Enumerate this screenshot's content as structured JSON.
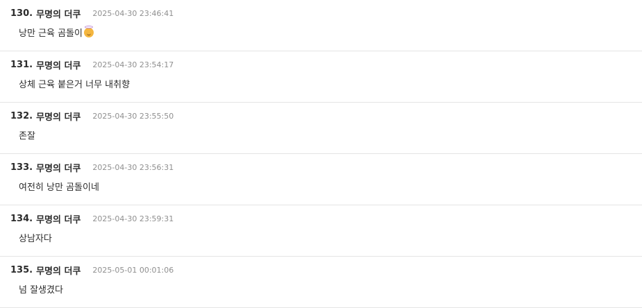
{
  "comments": [
    {
      "number": "130.",
      "author": "무명의 더쿠",
      "timestamp": "2025-04-30 23:46:41",
      "text": "낭만 근육 곰돌이",
      "emoji": "smiling-face-with-halo"
    },
    {
      "number": "131.",
      "author": "무명의 더쿠",
      "timestamp": "2025-04-30 23:54:17",
      "text": "상체 근육 붙은거 너무 내취향"
    },
    {
      "number": "132.",
      "author": "무명의 더쿠",
      "timestamp": "2025-04-30 23:55:50",
      "text": "존잘"
    },
    {
      "number": "133.",
      "author": "무명의 더쿠",
      "timestamp": "2025-04-30 23:56:31",
      "text": "여전히 낭만 곰돌이네"
    },
    {
      "number": "134.",
      "author": "무명의 더쿠",
      "timestamp": "2025-04-30 23:59:31",
      "text": "상남자다"
    },
    {
      "number": "135.",
      "author": "무명의 더쿠",
      "timestamp": "2025-05-01 00:01:06",
      "text": "넘 잘생겼다"
    }
  ]
}
